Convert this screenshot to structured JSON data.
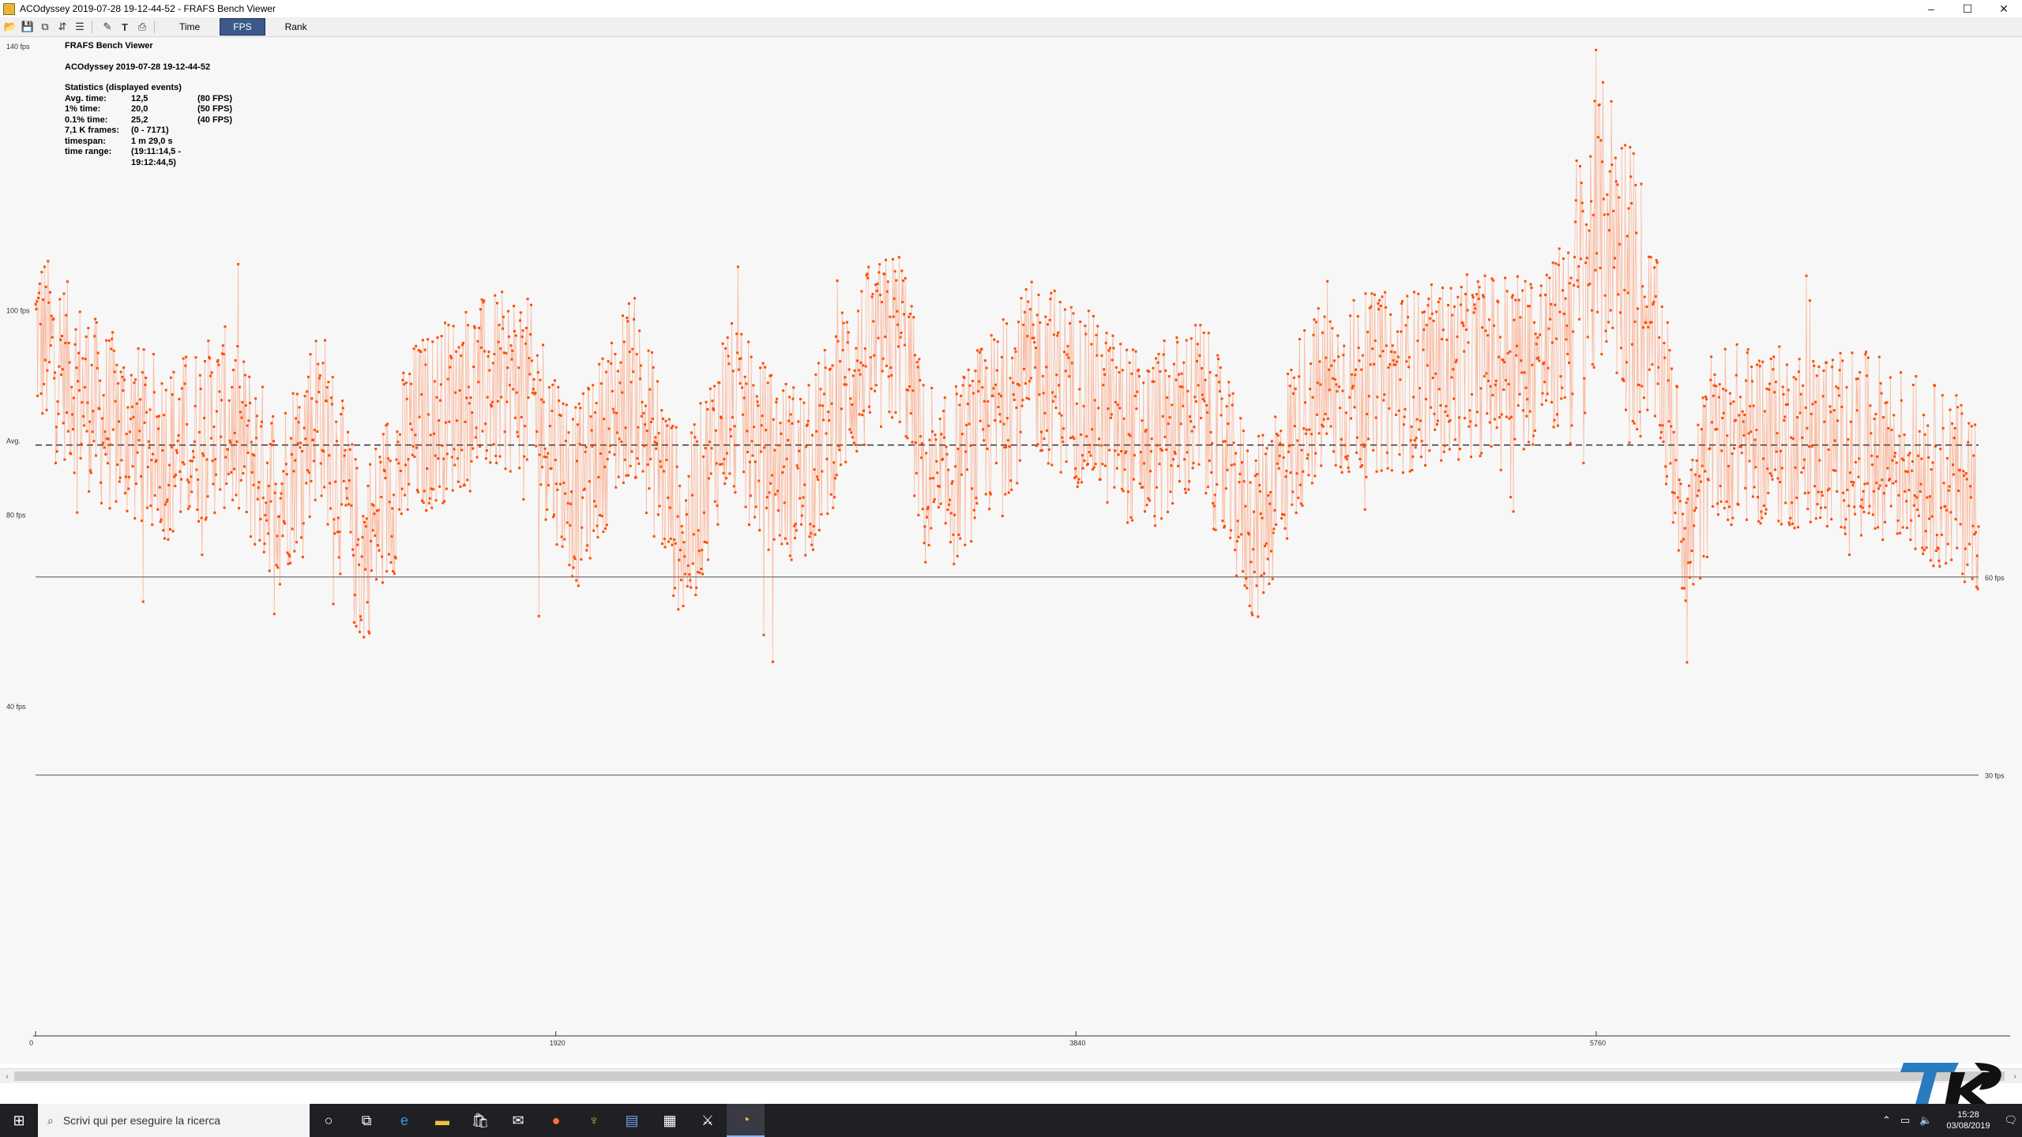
{
  "window": {
    "title": "ACOdyssey 2019-07-28 19-12-44-52 - FRAFS Bench Viewer",
    "controls": [
      "–",
      "☐",
      "✕"
    ]
  },
  "toolbar": {
    "icons": [
      "open-icon",
      "save-icon",
      "copy-icon",
      "compare-icon",
      "split-icon",
      "settings-icon",
      "text-icon",
      "print-icon"
    ],
    "tabs": [
      "Time",
      "FPS",
      "Rank"
    ],
    "active_tab": "FPS"
  },
  "overlay": {
    "app_name": "FRAFS Bench Viewer",
    "run_name": "ACOdyssey 2019-07-28 19-12-44-52",
    "stats_header": "Statistics (displayed events)",
    "rows": [
      {
        "key": "Avg. time:",
        "value": "12,5",
        "extra": "(80 FPS)"
      },
      {
        "key": "1% time:",
        "value": "20,0",
        "extra": "(50 FPS)"
      },
      {
        "key": "0.1% time:",
        "value": "25,2",
        "extra": "(40 FPS)"
      },
      {
        "key": "7,1 K frames:",
        "value": "(0 - 7171)",
        "extra": ""
      },
      {
        "key": "timespan:",
        "value": "1 m 29,0 s",
        "extra": ""
      },
      {
        "key": "time range:",
        "value": "(19:11:14,5 - 19:12:44,5)",
        "extra": ""
      }
    ]
  },
  "chart_data": {
    "type": "scatter",
    "title": "",
    "xlabel": "",
    "ylabel": "",
    "x_ticks": [
      "0",
      "1920",
      "3840",
      "5760"
    ],
    "y_ticks": [
      "140 fps",
      "100 fps",
      "Avg.",
      "80 fps",
      "40 fps"
    ],
    "reference_lines": [
      {
        "label": "Avg.",
        "fps": 80,
        "style": "dashed"
      },
      {
        "label": "60 fps",
        "fps": 60,
        "style": "solid"
      },
      {
        "label": "30 fps",
        "fps": 30,
        "style": "solid"
      }
    ],
    "xlim": [
      0,
      7171
    ],
    "series_color": "#ff4b00",
    "segments": [
      [
        0,
        97
      ],
      [
        250,
        84
      ],
      [
        500,
        79
      ],
      [
        700,
        84
      ],
      [
        900,
        72
      ],
      [
        1050,
        86
      ],
      [
        1200,
        62
      ],
      [
        1400,
        82
      ],
      [
        1600,
        88
      ],
      [
        1800,
        90
      ],
      [
        2000,
        72
      ],
      [
        2200,
        90
      ],
      [
        2400,
        65
      ],
      [
        2550,
        86
      ],
      [
        2700,
        78
      ],
      [
        2850,
        75
      ],
      [
        3000,
        90
      ],
      [
        3200,
        97
      ],
      [
        3300,
        70
      ],
      [
        3500,
        82
      ],
      [
        3700,
        92
      ],
      [
        3900,
        86
      ],
      [
        4100,
        80
      ],
      [
        4300,
        86
      ],
      [
        4500,
        66
      ],
      [
        4700,
        87
      ],
      [
        4900,
        89
      ],
      [
        5100,
        90
      ],
      [
        5300,
        92
      ],
      [
        5600,
        94
      ],
      [
        5800,
        115
      ],
      [
        6000,
        92
      ],
      [
        6100,
        65
      ],
      [
        6200,
        82
      ],
      [
        6500,
        81
      ],
      [
        6800,
        80
      ],
      [
        7171,
        72
      ]
    ]
  },
  "scrollbar": {
    "left": "‹",
    "right": "›"
  },
  "taskbar": {
    "search_placeholder": "Scrivi qui per eseguire la ricerca",
    "apps": [
      "cortana-icon",
      "task-view-icon",
      "edge-icon",
      "explorer-icon",
      "store-icon",
      "mail-icon",
      "firefox-icon",
      "app-icon",
      "notepad-icon",
      "photos-icon",
      "game-icon",
      "frafs-icon"
    ],
    "time": "15:28",
    "date": "03/08/2019"
  }
}
